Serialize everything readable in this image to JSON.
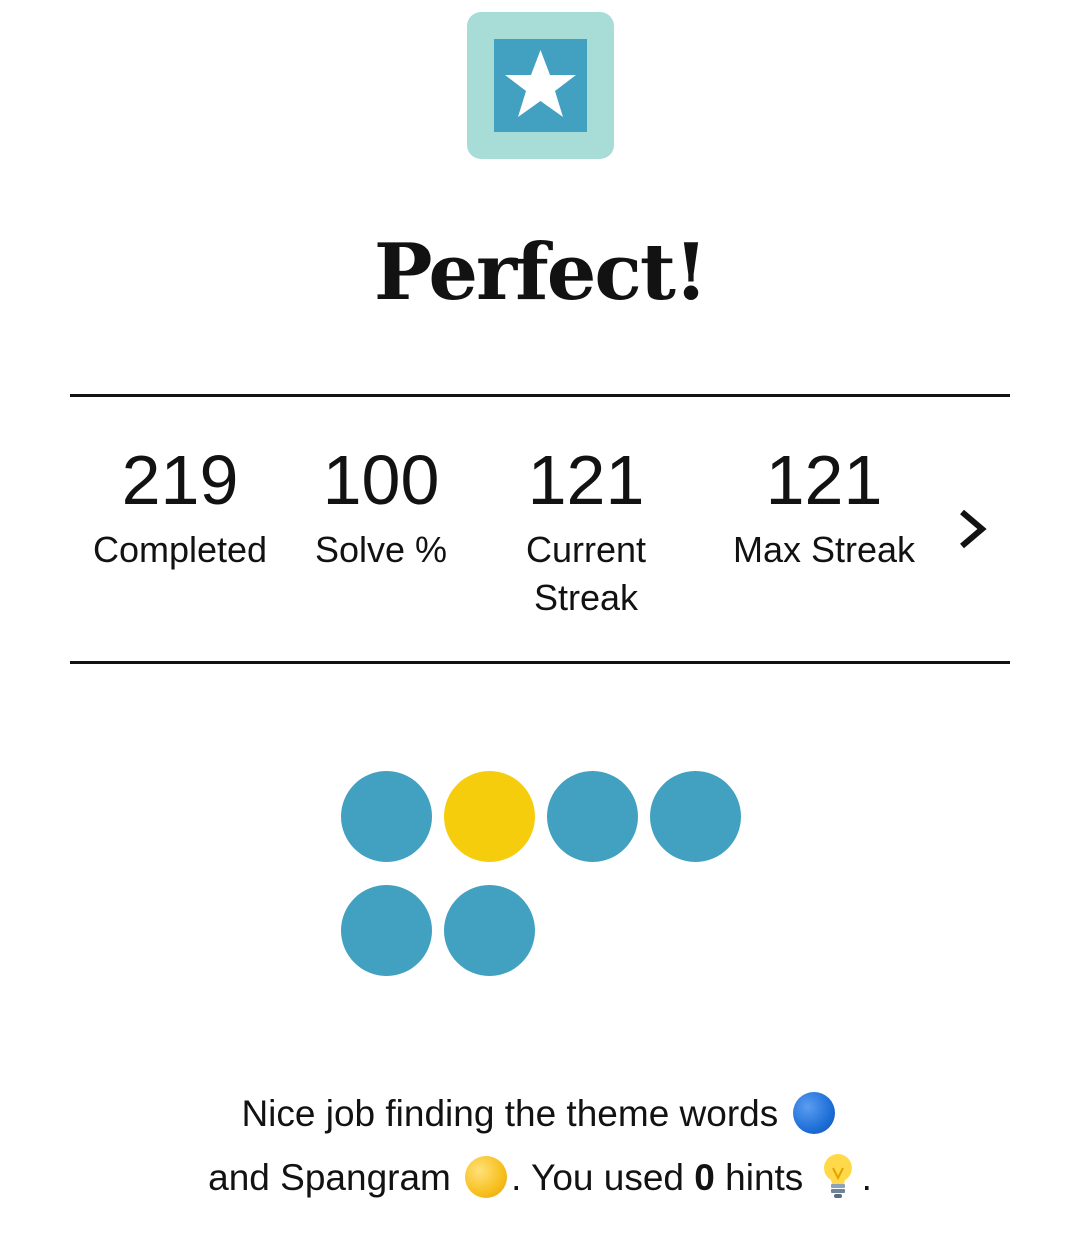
{
  "header": {
    "title": "Perfect!"
  },
  "stats": {
    "completed": {
      "value": "219",
      "label": "Completed"
    },
    "solve": {
      "value": "100",
      "label": "Solve %"
    },
    "current_streak": {
      "value": "121",
      "label_line1": "Current",
      "label_line2": "Streak"
    },
    "max_streak": {
      "value": "121",
      "label": "Max Streak"
    },
    "next_icon": "chevron-right-icon"
  },
  "results": {
    "dots": [
      "theme",
      "spangram",
      "theme",
      "theme",
      "theme",
      "theme"
    ],
    "colors": {
      "theme": "#42a0c0",
      "spangram": "#f6cd0d"
    }
  },
  "message": {
    "part1": "Nice job finding the theme words",
    "part2": "and Spangram",
    "part3": ". You used",
    "hints_count": "0",
    "part4": "hints",
    "part5": "."
  },
  "badge": {
    "icon": "star-icon",
    "outer_color": "#a7ddd6",
    "inner_color": "#42a0c0"
  }
}
